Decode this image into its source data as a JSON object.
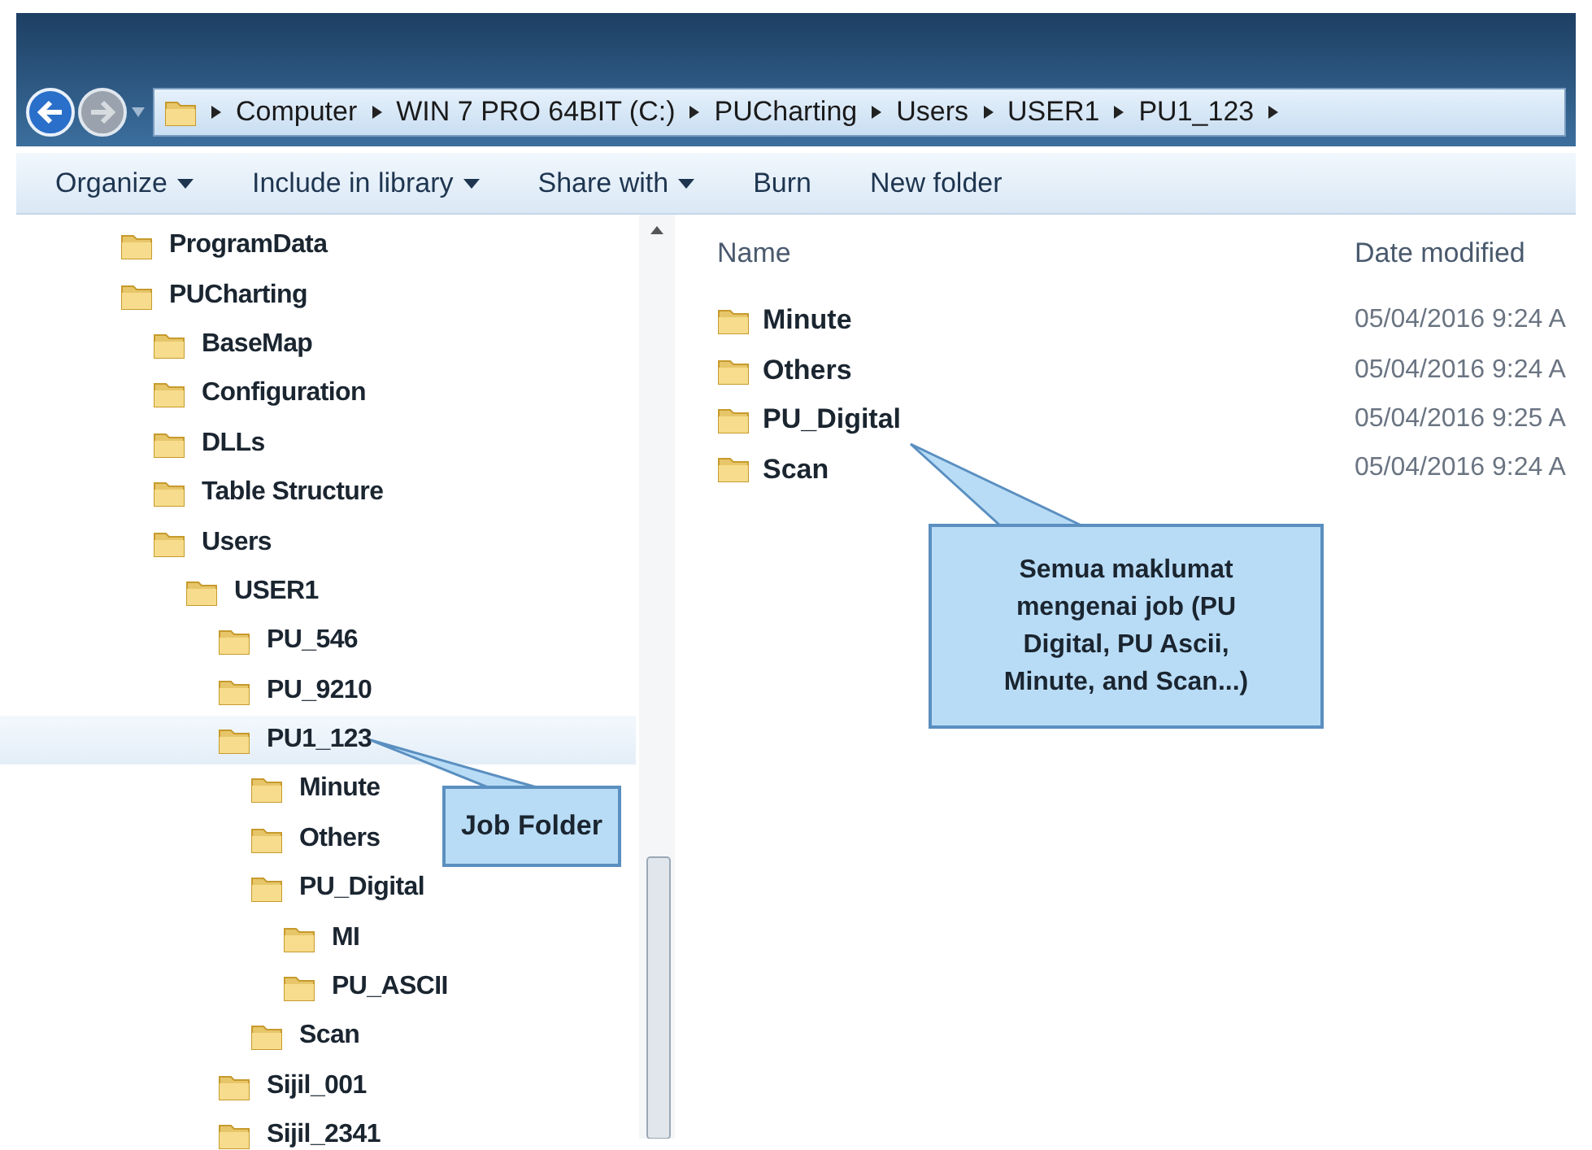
{
  "navigation": {
    "back": {
      "disabled": false
    },
    "forward": {
      "disabled": true
    }
  },
  "address_bar": {
    "breadcrumbs": [
      "Computer",
      "WIN 7 PRO 64BIT (C:)",
      "PUCharting",
      "Users",
      "USER1",
      "PU1_123"
    ]
  },
  "toolbar": [
    {
      "label": "Organize",
      "dropdown": true
    },
    {
      "label": "Include in library",
      "dropdown": true
    },
    {
      "label": "Share with",
      "dropdown": true
    },
    {
      "label": "Burn",
      "dropdown": false
    },
    {
      "label": "New folder",
      "dropdown": false
    }
  ],
  "navigation_tree": [
    {
      "label": "ProgramData",
      "selected": false
    },
    {
      "label": "PUCharting",
      "selected": false,
      "children": [
        {
          "label": "BaseMap",
          "selected": false
        },
        {
          "label": "Configuration",
          "selected": false
        },
        {
          "label": "DLLs",
          "selected": false
        },
        {
          "label": "Table Structure",
          "selected": false
        },
        {
          "label": "Users",
          "selected": false,
          "children": [
            {
              "label": "USER1",
              "selected": false,
              "children": [
                {
                  "label": "PU_546",
                  "selected": false
                },
                {
                  "label": "PU_9210",
                  "selected": false
                },
                {
                  "label": "PU1_123",
                  "selected": true,
                  "children": [
                    {
                      "label": "Minute",
                      "selected": false
                    },
                    {
                      "label": "Others",
                      "selected": false
                    },
                    {
                      "label": "PU_Digital",
                      "selected": false,
                      "children": [
                        {
                          "label": "MI",
                          "selected": false
                        },
                        {
                          "label": "PU_ASCII",
                          "selected": false
                        }
                      ]
                    },
                    {
                      "label": "Scan",
                      "selected": false
                    }
                  ]
                },
                {
                  "label": "Sijil_001",
                  "selected": false
                },
                {
                  "label": "Sijil_2341",
                  "selected": false
                }
              ]
            }
          ]
        }
      ]
    }
  ],
  "file_list": {
    "columns": [
      "Name",
      "Date modified"
    ],
    "rows": [
      {
        "name": "Minute",
        "date_modified": "05/04/2016 9:24 A"
      },
      {
        "name": "Others",
        "date_modified": "05/04/2016 9:24 A"
      },
      {
        "name": "PU_Digital",
        "date_modified": "05/04/2016 9:25 A"
      },
      {
        "name": "Scan",
        "date_modified": "05/04/2016 9:24 A"
      }
    ]
  },
  "callouts": [
    {
      "text": "Job Folder"
    },
    {
      "text": "Semua maklumat mengenai job (PU Digital, PU Ascii, Minute, and Scan...)"
    }
  ]
}
